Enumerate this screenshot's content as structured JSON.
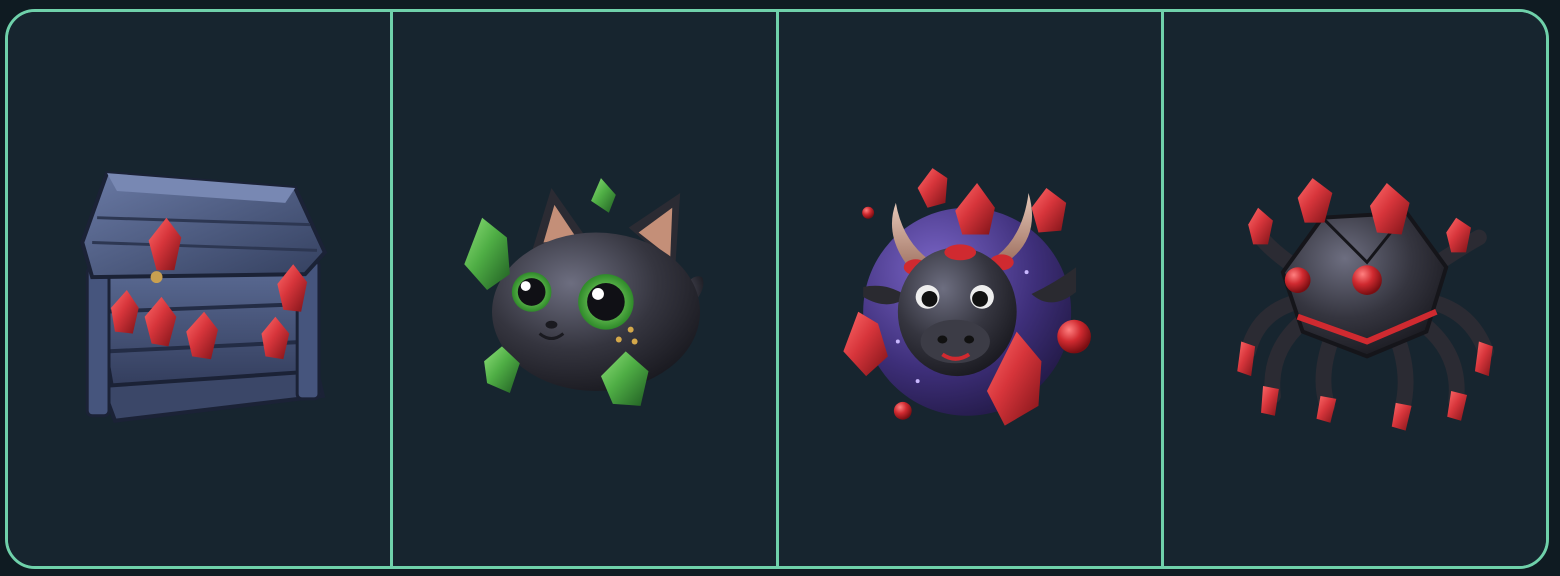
{
  "colors": {
    "background": "#0f1b22",
    "panel": "#17252f",
    "frame_border": "#6fd1aa",
    "gem_red": "#d7353b",
    "gem_green": "#4fae45"
  },
  "items": [
    {
      "icon": "gem-treasure-chest-icon"
    },
    {
      "icon": "black-cat-with-green-gems-icon"
    },
    {
      "icon": "black-bull-with-red-gems-icon"
    },
    {
      "icon": "black-spider-with-red-gems-icon"
    }
  ]
}
